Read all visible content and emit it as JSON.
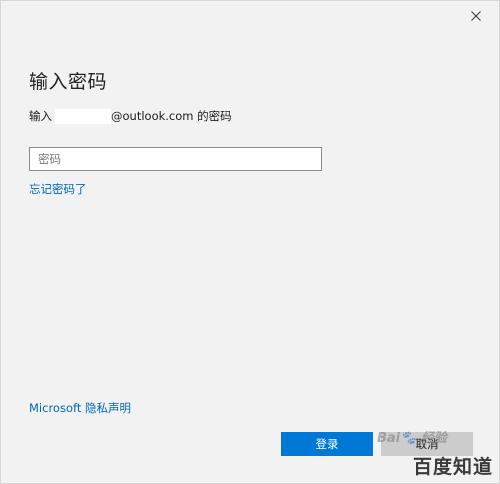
{
  "dialog": {
    "heading": "输入密码",
    "prompt_prefix": "输入",
    "prompt_suffix": "@outlook.com 的密码",
    "password_placeholder": "密码",
    "password_value": "",
    "forgot_link": "忘记密码了",
    "privacy_link": "Microsoft 隐私声明",
    "login_button": "登录",
    "cancel_button": "取消"
  },
  "watermark": {
    "top_text": "Bai🐾 经验",
    "bottom_text": "百度知道"
  },
  "colors": {
    "accent": "#0078d7",
    "link": "#0067b8",
    "window_bg": "#f2f2f2"
  },
  "icons": {
    "close": "close-icon"
  }
}
